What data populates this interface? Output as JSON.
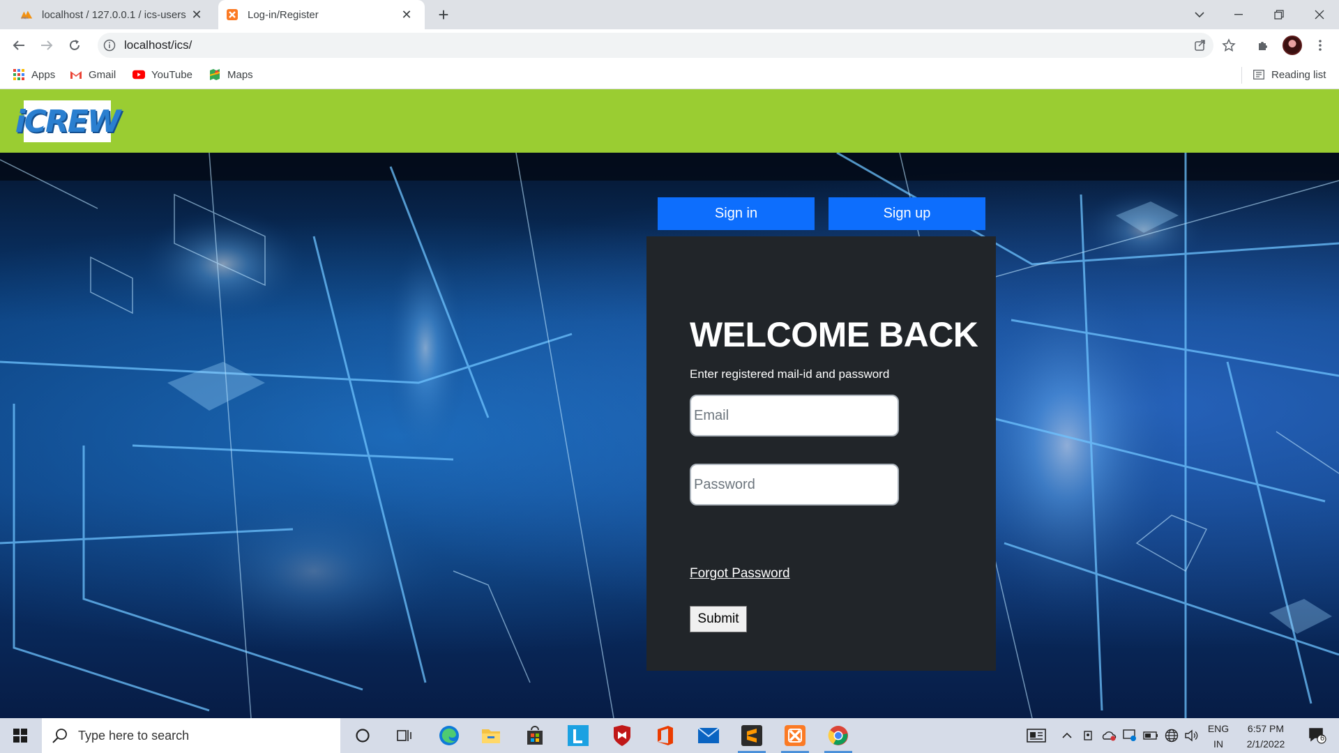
{
  "browser": {
    "tabs": [
      {
        "title": "localhost / 127.0.0.1 / ics-users /",
        "icon": "phpmyadmin-icon",
        "active": false
      },
      {
        "title": "Log-in/Register",
        "icon": "xampp-icon",
        "active": true
      }
    ],
    "url": "localhost/ics/",
    "bookmarks": [
      {
        "label": "Apps",
        "icon": "apps-grid-icon"
      },
      {
        "label": "Gmail",
        "icon": "gmail-icon"
      },
      {
        "label": "YouTube",
        "icon": "youtube-icon"
      },
      {
        "label": "Maps",
        "icon": "maps-icon"
      }
    ],
    "reading_list": "Reading list"
  },
  "site": {
    "logo_text": "iCREW",
    "colors": {
      "header": "#9acd32",
      "primary": "#0d6efd",
      "card": "#212529"
    }
  },
  "auth": {
    "tabs": {
      "signin": "Sign in",
      "signup": "Sign up"
    },
    "heading": "WELCOME BACK",
    "subheading": "Enter registered mail-id and password",
    "email_placeholder": "Email",
    "password_placeholder": "Password",
    "forgot": "Forgot Password",
    "submit": "Submit"
  },
  "taskbar": {
    "search_placeholder": "Type here to search",
    "lang": {
      "line1": "ENG",
      "line2": "IN"
    },
    "time": "6:57 PM",
    "date": "2/1/2022",
    "notifications": "6"
  }
}
